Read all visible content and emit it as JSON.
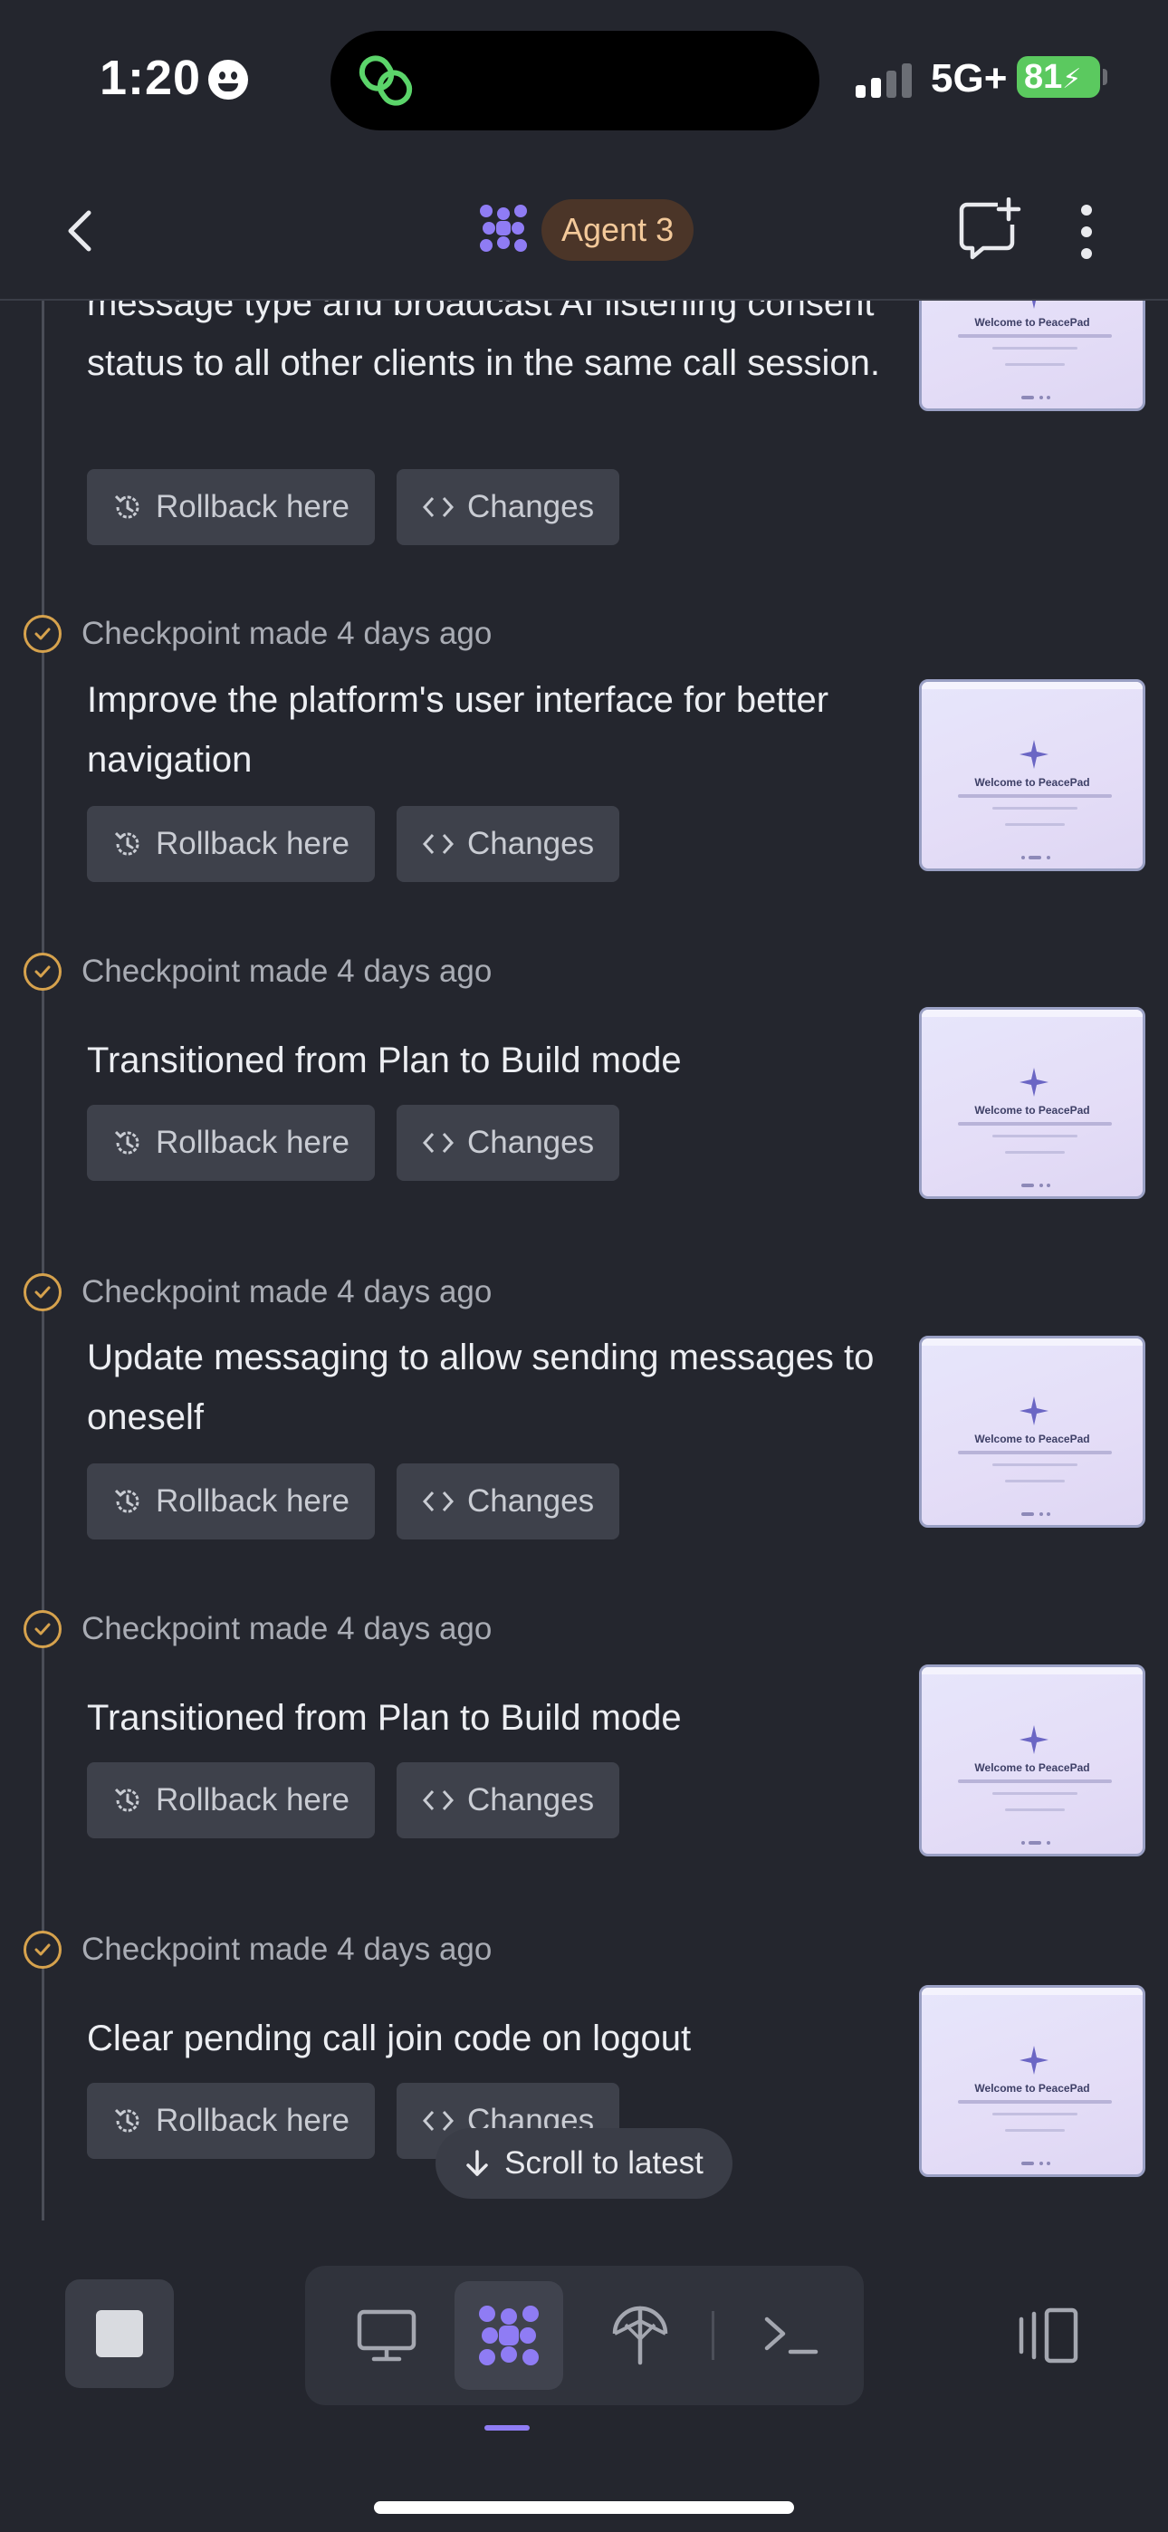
{
  "status_bar": {
    "time": "1:20",
    "network": "5G+",
    "battery": "81"
  },
  "header": {
    "agent_label": "Agent 3"
  },
  "entries": [
    {
      "text": "message type and broadcast AI listening consent status to all other clients in the same call session.",
      "checkpoint": null
    },
    {
      "text": "Improve the platform's user interface for better navigation",
      "checkpoint": {
        "label": "Checkpoint made",
        "age": "4 days ago"
      }
    },
    {
      "text": "Transitioned from Plan to Build mode",
      "checkpoint": {
        "label": "Checkpoint made",
        "age": "4 days ago"
      }
    },
    {
      "text": "Update messaging to allow sending messages to oneself",
      "checkpoint": {
        "label": "Checkpoint made",
        "age": "4 days ago"
      }
    },
    {
      "text": "Transitioned from Plan to Build mode",
      "checkpoint": {
        "label": "Checkpoint made",
        "age": "4 days ago"
      }
    },
    {
      "text": "Clear pending call join code on logout",
      "checkpoint": {
        "label": "Checkpoint made",
        "age": "4 days ago"
      }
    }
  ],
  "buttons": {
    "rollback": "Rollback here",
    "changes": "Changes"
  },
  "thumbnail": {
    "title": "Welcome to PeacePad"
  },
  "scroll_to_latest": "Scroll to latest",
  "toolbar": {
    "tools": [
      "preview-icon",
      "agent-icon",
      "deployments-icon",
      "shell-icon"
    ],
    "active_tool": "agent-icon"
  },
  "colors": {
    "accent": "#8f7cf4",
    "checkpoint": "#d6a24d",
    "badge_bg": "#4b3528",
    "badge_text": "#f3c99a"
  }
}
